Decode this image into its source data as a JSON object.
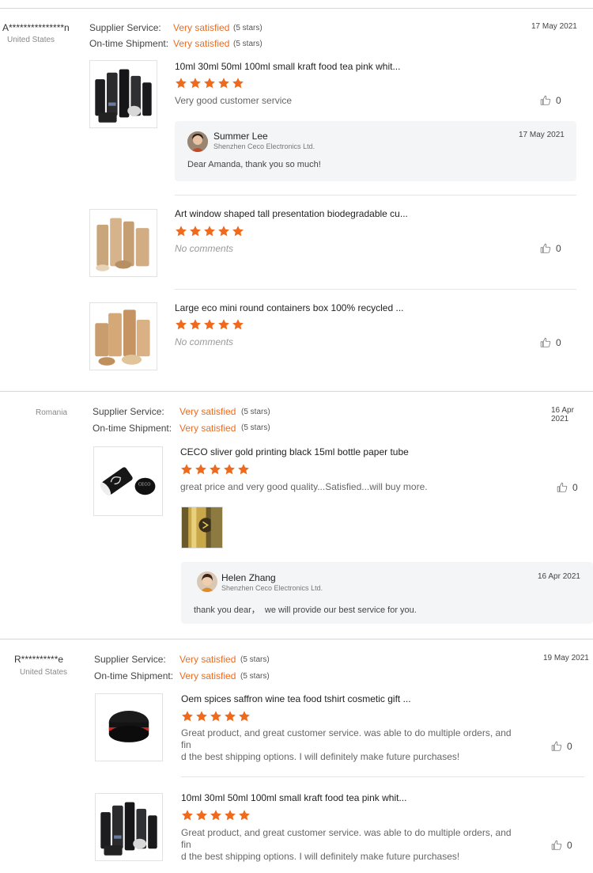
{
  "colors": {
    "accent": "#ef6a1c",
    "star": "#ef6a1c",
    "divider": "#d8d8d8",
    "reply_bg": "#f4f5f7"
  },
  "icons": {
    "star": "star-icon",
    "like": "thumbs-up-icon"
  },
  "reviews": [
    {
      "buyer": "A***************n",
      "country": "United States",
      "supplier_label": "Supplier Service:",
      "supplier_value": "Very satisfied",
      "supplier_stars": "(5 stars)",
      "shipment_label": "On-time Shipment:",
      "shipment_value": "Very satisfied",
      "shipment_stars": "(5 stars)",
      "date": "17 May 2021",
      "items": [
        {
          "title": "10ml 30ml 50ml 100ml small kraft food tea pink whit...",
          "rating": 5,
          "comment": "Very good customer service",
          "likes": "0",
          "reply": {
            "name": "Summer Lee",
            "company": "Shenzhen Ceco Electronics Ltd.",
            "date": "17 May 2021",
            "text": "Dear Amanda, thank you so much!"
          }
        },
        {
          "title": "Art window shaped tall presentation biodegradable cu...",
          "rating": 5,
          "comment": "No comments",
          "likes": "0"
        },
        {
          "title": "Large eco mini round containers box 100% recycled ...",
          "rating": 5,
          "comment": "No comments",
          "likes": "0"
        }
      ]
    },
    {
      "buyer": "",
      "country": "Romania",
      "supplier_label": "Supplier Service:",
      "supplier_value": "Very satisfied",
      "supplier_stars": "(5 stars)",
      "shipment_label": "On-time Shipment:",
      "shipment_value": "Very satisfied",
      "shipment_stars": "(5 stars)",
      "date": "16 Apr 2021",
      "items": [
        {
          "title": "CECO sliver gold printing black 15ml bottle paper tube",
          "rating": 5,
          "comment": "great price and very good quality...Satisfied...will buy more.",
          "likes": "0",
          "reply": {
            "name": "Helen Zhang",
            "company": "Shenzhen Ceco Electronics Ltd.",
            "date": "16 Apr 2021",
            "text": "thank you dear，  we will provide our best service for you."
          }
        }
      ]
    },
    {
      "buyer": "R**********e",
      "country": "United States",
      "supplier_label": "Supplier Service:",
      "supplier_value": "Very satisfied",
      "supplier_stars": "(5 stars)",
      "shipment_label": "On-time Shipment:",
      "shipment_value": "Very satisfied",
      "shipment_stars": "(5 stars)",
      "date": "19 May 2021",
      "items": [
        {
          "title": "Oem spices saffron wine tea food tshirt cosmetic gift ...",
          "rating": 5,
          "comment_line1": "Great product, and great customer service. was able to do multiple orders, and fin",
          "comment_line2": "d the best shipping options. I will definitely make future purchases!",
          "likes": "0"
        },
        {
          "title": "10ml 30ml 50ml 100ml small kraft food tea pink whit...",
          "rating": 5,
          "comment_line1": "Great product, and great customer service. was able to do multiple orders, and fin",
          "comment_line2": "d the best shipping options. I will definitely make future purchases!",
          "likes": "0"
        }
      ]
    }
  ]
}
